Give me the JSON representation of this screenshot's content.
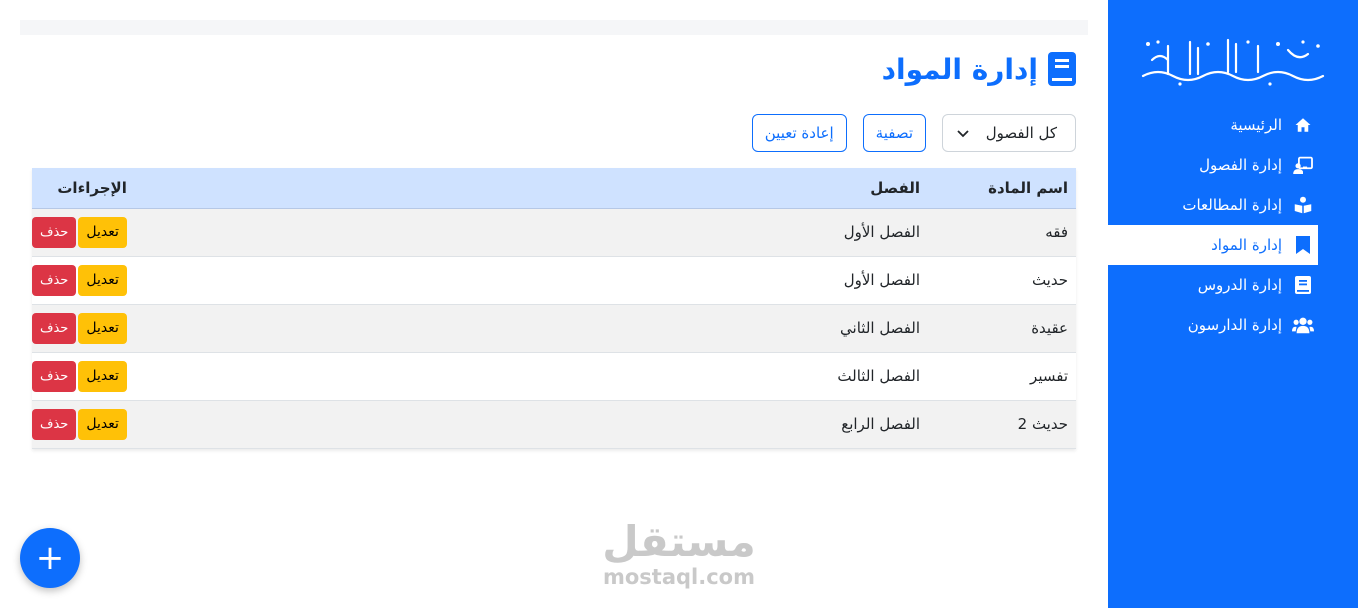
{
  "sidebar": {
    "logo_text": "مدرسة أهل الحديث",
    "items": [
      {
        "label": "الرئيسية",
        "icon": "home-icon",
        "active": false
      },
      {
        "label": "إدارة الفصول",
        "icon": "chalkboard-teacher-icon",
        "active": false
      },
      {
        "label": "إدارة المطالعات",
        "icon": "book-reader-icon",
        "active": false
      },
      {
        "label": "إدارة المواد",
        "icon": "bookmark-icon",
        "active": true
      },
      {
        "label": "إدارة الدروس",
        "icon": "book-icon",
        "active": false
      },
      {
        "label": "إدارة الدارسون",
        "icon": "users-icon",
        "active": false
      }
    ]
  },
  "page": {
    "title": "إدارة المواد",
    "title_icon": "book-icon"
  },
  "filters": {
    "select_value": "كل الفصول",
    "filter_label": "تصفية",
    "reset_label": "إعادة تعيين"
  },
  "table": {
    "headers": {
      "name": "اسم المادة",
      "class": "الفصل",
      "actions": "الإجراءات"
    },
    "rows": [
      {
        "name": "فقه",
        "class": "الفصل الأول"
      },
      {
        "name": "حديث",
        "class": "الفصل الأول"
      },
      {
        "name": "عقيدة",
        "class": "الفصل الثاني"
      },
      {
        "name": "تفسير",
        "class": "الفصل الثالث"
      },
      {
        "name": "حديث 2",
        "class": "الفصل الرابع"
      }
    ],
    "edit_label": "تعديل",
    "delete_label": "حذف"
  },
  "fab": {
    "label": "+"
  },
  "watermark": {
    "arabic": "مستقل",
    "latin": "mostaql.com"
  },
  "colors": {
    "primary": "#0d6efd",
    "warning": "#ffc107",
    "danger": "#dc3545",
    "header_bg": "#cfe2ff"
  }
}
